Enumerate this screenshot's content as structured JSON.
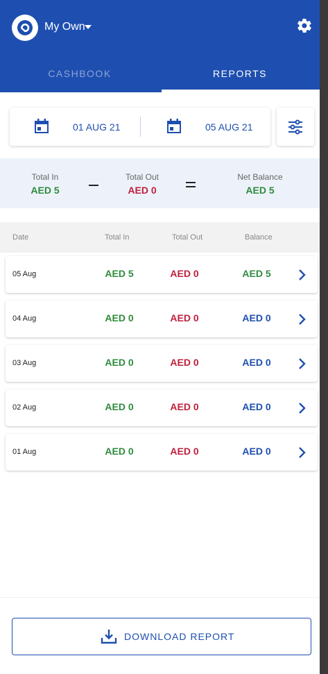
{
  "header": {
    "book_name": "My Own",
    "tabs": [
      "CASHBOOK",
      "REPORTS"
    ],
    "active_tab": "REPORTS"
  },
  "date_range": {
    "start": "01 AUG 21",
    "end": "05 AUG 21"
  },
  "totals": {
    "in_label": "Total In",
    "in_value": "AED 5",
    "out_label": "Total Out",
    "out_value": "AED 0",
    "net_label": "Net Balance",
    "net_value": "AED 5"
  },
  "table": {
    "headers": [
      "Date",
      "Total In",
      "Total Out",
      "Balance"
    ],
    "rows": [
      {
        "date": "05 Aug",
        "in": "AED 5",
        "out": "AED 0",
        "balance": "AED 5",
        "balance_color": "green"
      },
      {
        "date": "04 Aug",
        "in": "AED 0",
        "out": "AED 0",
        "balance": "AED 0",
        "balance_color": "blue"
      },
      {
        "date": "03 Aug",
        "in": "AED 0",
        "out": "AED 0",
        "balance": "AED 0",
        "balance_color": "blue"
      },
      {
        "date": "02 Aug",
        "in": "AED 0",
        "out": "AED 0",
        "balance": "AED 0",
        "balance_color": "blue"
      },
      {
        "date": "01 Aug",
        "in": "AED 0",
        "out": "AED 0",
        "balance": "AED 0",
        "balance_color": "blue"
      }
    ]
  },
  "footer": {
    "download_label": "DOWNLOAD REPORT"
  },
  "colors": {
    "primary": "#1e4fb0",
    "in": "#2e8b3d",
    "out": "#c0203d",
    "balance_zero": "#1e4fb0",
    "totals_bg": "#edf2fa"
  },
  "icons": [
    "app-logo-icon",
    "caret-down-icon",
    "gear-icon",
    "calendar-icon",
    "filter-sliders-icon",
    "chevron-right-icon",
    "download-icon"
  ]
}
